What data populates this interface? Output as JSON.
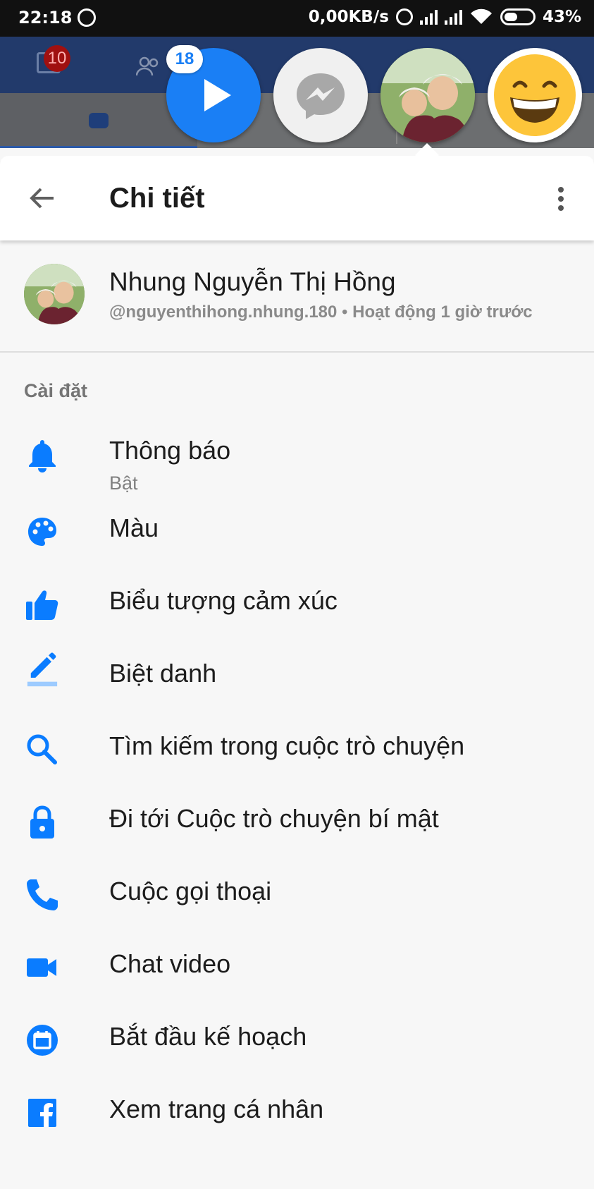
{
  "status_bar": {
    "time": "22:18",
    "network_speed": "0,00KB/s",
    "battery": "43%",
    "icons": [
      "messenger-icon",
      "alarm-icon",
      "signal-icon",
      "signal-icon",
      "wifi-icon",
      "battery-icon"
    ]
  },
  "background_app": {
    "notification_count": "10"
  },
  "chat_heads": {
    "play_badge": "18",
    "items": [
      "play-head",
      "messenger-head",
      "contact-photo-head",
      "grinning-emoji-head"
    ]
  },
  "toolbar": {
    "title": "Chi tiết",
    "back_icon": "arrow-left-icon",
    "more_icon": "more-vert-icon"
  },
  "profile": {
    "name": "Nhung Nguyễn Thị Hồng",
    "username": "@nguyenthihong.nhung.180",
    "separator": " • ",
    "activity": "Hoạt động 1 giờ trước"
  },
  "settings": {
    "section_label": "Cài đặt",
    "accent_color": "#0a7cff",
    "items": [
      {
        "label": "Thông báo",
        "sub": "Bật",
        "icon": "bell-icon"
      },
      {
        "label": "Màu",
        "icon": "palette-icon"
      },
      {
        "label": "Biểu tượng cảm xúc",
        "icon": "thumbs-up-icon"
      },
      {
        "label": "Biệt danh",
        "icon": "pencil-icon"
      },
      {
        "label": "Tìm kiếm trong cuộc trò chuyện",
        "icon": "search-icon"
      },
      {
        "label": "Đi tới Cuộc trò chuyện bí mật",
        "icon": "lock-icon"
      },
      {
        "label": "Cuộc gọi thoại",
        "icon": "phone-icon"
      },
      {
        "label": "Chat video",
        "icon": "video-camera-icon"
      },
      {
        "label": "Bắt đầu kế hoạch",
        "icon": "calendar-icon"
      },
      {
        "label": "Xem trang cá nhân",
        "icon": "facebook-icon"
      }
    ]
  }
}
